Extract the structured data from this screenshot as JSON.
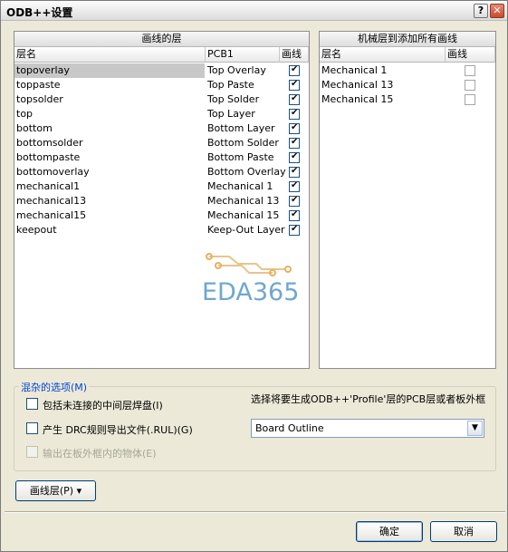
{
  "window": {
    "title": "ODB++设置",
    "help_glyph": "?",
    "close_glyph": "✕"
  },
  "left_panel": {
    "header": "画线的层",
    "columns": [
      "层名",
      "PCB1",
      "画线"
    ],
    "rows": [
      {
        "name": "topoverlay",
        "pcb": "Top Overlay",
        "checked": true
      },
      {
        "name": "toppaste",
        "pcb": "Top Paste",
        "checked": true
      },
      {
        "name": "topsolder",
        "pcb": "Top Solder",
        "checked": true
      },
      {
        "name": "top",
        "pcb": "Top Layer",
        "checked": true
      },
      {
        "name": "bottom",
        "pcb": "Bottom Layer",
        "checked": true
      },
      {
        "name": "bottomsolder",
        "pcb": "Bottom Solder",
        "checked": true
      },
      {
        "name": "bottompaste",
        "pcb": "Bottom Paste",
        "checked": true
      },
      {
        "name": "bottomoverlay",
        "pcb": "Bottom Overlay",
        "checked": true
      },
      {
        "name": "mechanical1",
        "pcb": "Mechanical 1",
        "checked": true
      },
      {
        "name": "mechanical13",
        "pcb": "Mechanical 13",
        "checked": true
      },
      {
        "name": "mechanical15",
        "pcb": "Mechanical 15",
        "checked": true
      },
      {
        "name": "keepout",
        "pcb": "Keep-Out Layer",
        "checked": true
      }
    ]
  },
  "right_panel": {
    "header": "机械层到添加所有画线",
    "columns": [
      "层名",
      "画线"
    ],
    "rows": [
      {
        "name": "Mechanical 1",
        "checked": false
      },
      {
        "name": "Mechanical 13",
        "checked": false
      },
      {
        "name": "Mechanical 15",
        "checked": false
      }
    ]
  },
  "watermark": {
    "text": "EDA365",
    "color": "#6fa7cf"
  },
  "options": {
    "legend": "混杂的选项(M)",
    "include_unconnected": {
      "label": "包括未连接的中间层焊盘(I)",
      "checked": false
    },
    "export_drc": {
      "label": "产生 DRC规则导出文件(.RUL)(G)",
      "checked": false
    },
    "output_outside": {
      "label": "输出在板外框内的物体(E)",
      "checked": false,
      "disabled": true
    },
    "profile_label": "选择将要生成ODB++'Profile'层的PCB层或者板外框",
    "profile_value": "Board Outline"
  },
  "buttons": {
    "draw_layers": "画线层(P) ▾",
    "ok": "确定",
    "cancel": "取消"
  },
  "colors": {
    "accent": "#0046d5",
    "window_bg": "#ece9d8"
  }
}
